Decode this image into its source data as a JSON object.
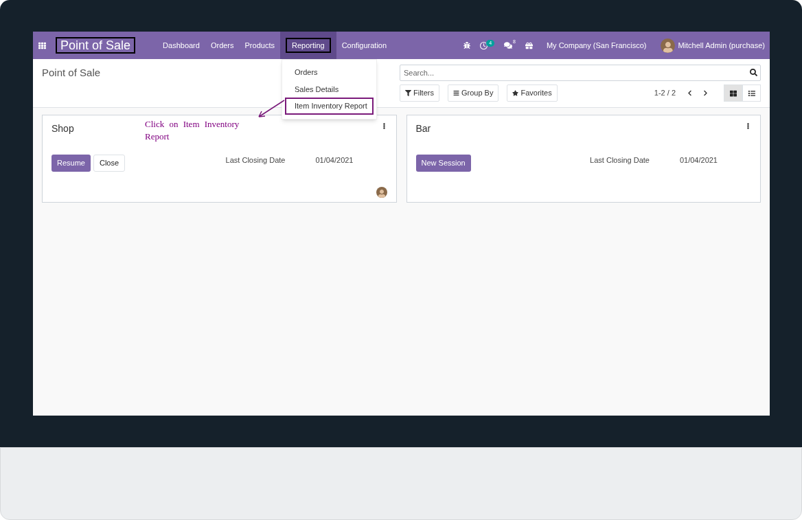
{
  "navbar": {
    "app_title": "Point of Sale",
    "menu": [
      {
        "label": "Dashboard",
        "selected": false
      },
      {
        "label": "Orders",
        "selected": false
      },
      {
        "label": "Products",
        "selected": false
      },
      {
        "label": "Reporting",
        "selected": true
      },
      {
        "label": "Configuration",
        "selected": false
      }
    ],
    "activity_count": "4",
    "message_count": "8",
    "company": "My Company (San Francisco)",
    "user": "Mitchell Admin (purchase)"
  },
  "dropdown": {
    "items": [
      {
        "label": "Orders",
        "selected": false
      },
      {
        "label": "Sales Details",
        "selected": false
      },
      {
        "label": "Item Inventory Report",
        "selected": true
      }
    ]
  },
  "breadcrumb": "Point of Sale",
  "search": {
    "placeholder": "Search..."
  },
  "filters": [
    {
      "kind": "filter",
      "label": "Filters"
    },
    {
      "kind": "group",
      "label": "Group By"
    },
    {
      "kind": "favorite",
      "label": "Favorites"
    }
  ],
  "pager": "1-2 / 2",
  "views": [
    {
      "kind": "kanban",
      "selected": true
    },
    {
      "kind": "list",
      "selected": false
    }
  ],
  "cards": [
    {
      "name": "Shop",
      "buttons": [
        {
          "kind": "primary",
          "label": "Resume"
        },
        {
          "kind": "secondary",
          "label": "Close"
        }
      ],
      "info_label": "Last Closing Date",
      "info_value": "01/04/2021",
      "user_avatar": true
    },
    {
      "name": "Bar",
      "buttons": [
        {
          "kind": "primary",
          "label": "New Session"
        }
      ],
      "info_label": "Last Closing Date",
      "info_value": "01/04/2021",
      "user_avatar": false
    }
  ],
  "annotation": {
    "text": "Click on Item Inventory Report"
  }
}
